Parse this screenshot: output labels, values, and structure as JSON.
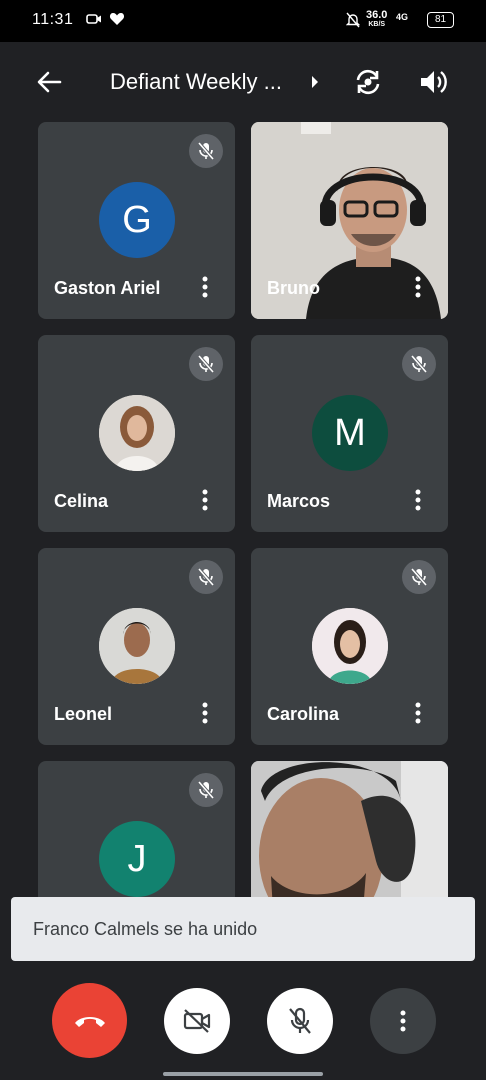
{
  "status_bar": {
    "time": "11:31",
    "network_speed": "36.0",
    "network_unit": "KB/S",
    "signal": "4G",
    "battery": "81"
  },
  "header": {
    "title": "Defiant Weekly ..."
  },
  "participants": [
    {
      "name": "Gaston Ariel",
      "initial": "G",
      "avatar_color": "#1a5fa8",
      "muted": true
    },
    {
      "name": "Bruno",
      "video": true
    },
    {
      "name": "Celina",
      "avatar_photo": true,
      "muted": true
    },
    {
      "name": "Marcos",
      "initial": "M",
      "avatar_color": "#0d4d3e",
      "muted": true
    },
    {
      "name": "Leonel",
      "avatar_photo": true,
      "muted": true
    },
    {
      "name": "Carolina",
      "avatar_photo": true,
      "muted": true
    },
    {
      "initial": "J",
      "avatar_color": "#12826f",
      "muted": true
    },
    {
      "video": true
    }
  ],
  "toast": {
    "message": "Franco Calmels se ha unido"
  },
  "colors": {
    "background": "#202124",
    "tile": "#3c4043",
    "end_call": "#ea4335"
  }
}
